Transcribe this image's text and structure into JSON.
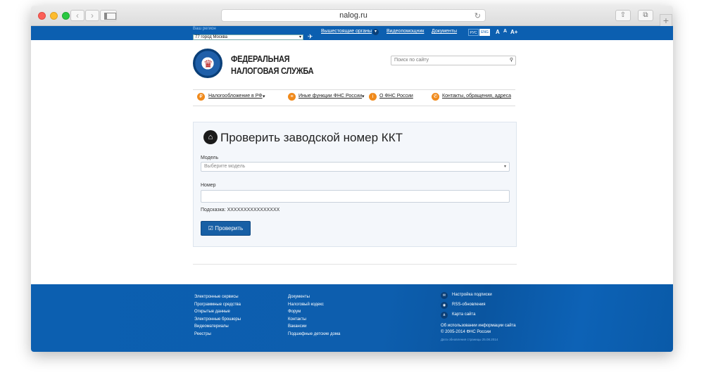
{
  "browser": {
    "url": "nalog.ru",
    "back": "‹",
    "forward": "›",
    "share": "⇧",
    "tabs": "⧉",
    "new_tab": "+"
  },
  "topbar": {
    "region_label": "Ваш регион",
    "region_value": "77 город Москва",
    "links": [
      "Вышестоящие органы",
      "Видеопомощник",
      "Документы"
    ],
    "lang_ru": "РУС",
    "lang_en": "ENG",
    "font_sizes": [
      "А",
      "А",
      "А+"
    ]
  },
  "header": {
    "logo_line1": "ФЕДЕРАЛЬНАЯ",
    "logo_line2": "НАЛОГОВАЯ СЛУЖБА",
    "search_placeholder": "Поиск по сайту"
  },
  "nav": {
    "items": [
      "Налогообложение в РФ",
      "Иные функции ФНС России",
      "О ФНС России",
      "Контакты, обращения, адреса"
    ]
  },
  "form": {
    "title": "Проверить заводской номер ККТ",
    "model_label": "Модель",
    "model_placeholder": "Выберите модель",
    "number_label": "Номер",
    "number_value": "",
    "hint": "Подсказка: XXXXXXXXXXXXXXXX",
    "submit_label": "Проверить"
  },
  "footer": {
    "col1": [
      "Электронные сервисы",
      "Программные средства",
      "Открытые данные",
      "Электронные брошюры",
      "Видеоматериалы",
      "Реестры"
    ],
    "col2": [
      "Документы",
      "Налоговый кодекс",
      "Форум",
      "Контакты",
      "Вакансии",
      "Подшефные детские дома"
    ],
    "right_links": [
      "Настройка подписки",
      "RSS-обновления",
      "Карта сайта"
    ],
    "info_line1": "Об использовании информации сайта",
    "info_line2": "© 2005-2014 ФНС России",
    "updated": "Дата обновления страницы 25.08.2014"
  },
  "colors": {
    "brand_blue": "#0c5fb0",
    "button_blue": "#175fa5",
    "nav_icon_orange": "#f08a1c"
  }
}
